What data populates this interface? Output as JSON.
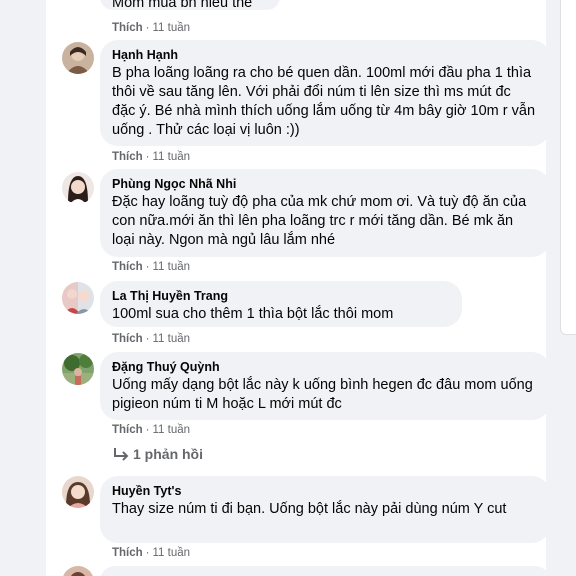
{
  "like_label": "Thích",
  "separator": "·",
  "top_partial": {
    "text": "Mom mua bn nieu the",
    "time": "11 tuần"
  },
  "comments": [
    {
      "name": "Hạnh Hạnh",
      "text": "B pha loãng loãng ra cho bé quen dần. 100ml mới đầu pha 1 thìa thôi về sau tăng lên. Với phải đổi núm ti lên size thì ms mút đc đặc ý. Bé nhà mình thích uống lắm uống từ 4m bây giờ 10m r vẫn uống . Thử các loại vị luôn :))",
      "time": "11 tuần"
    },
    {
      "name": "Phùng Ngọc Nhã Nhi",
      "text": "Đặc hay loãng tuỳ độ pha của mk chứ mom ơi. Và tuỳ độ ăn của con nữa.mới ăn thì lên pha loãng trc r mới tăng dần. Bé mk ăn loại này. Ngon mà ngủ lâu lắm nhé",
      "time": "11 tuần"
    },
    {
      "name": "La Thị Huyền Trang",
      "text": "100ml sua cho thêm 1 thìa bột lắc thôi mom",
      "time": "11 tuần"
    },
    {
      "name": "Đặng Thuý Quỳnh",
      "text": "Uống mấy dạng bột lắc này k uống bình hegen đc đâu mom uống pigieon núm ti M hoặc L mới mút đc",
      "time": "11 tuần",
      "replies": "1 phản hồi"
    },
    {
      "name": "Huyền Tyt's",
      "text": "Thay size núm ti đi bạn. Uống bột lắc này pải dùng núm Y cut",
      "time": "11 tuần"
    }
  ],
  "colors": {
    "bubble": "#f0f2f5",
    "name": "#050505",
    "meta": "#65676b",
    "page_bg": "#f0f2f5"
  }
}
